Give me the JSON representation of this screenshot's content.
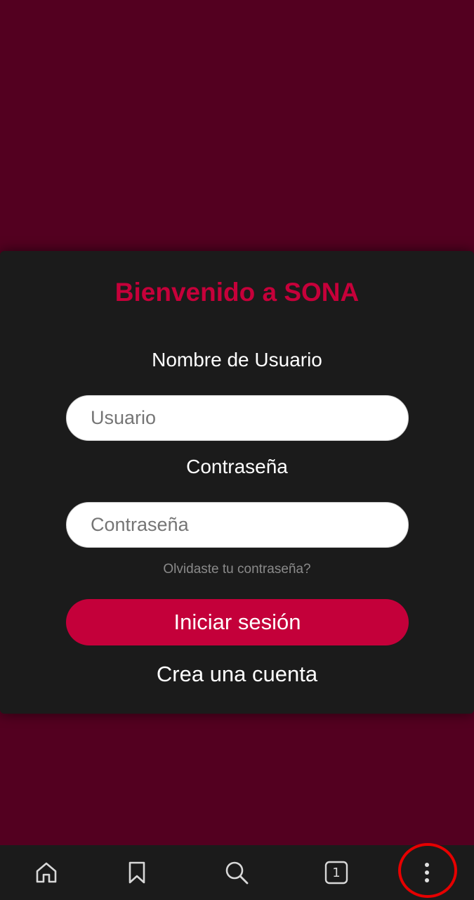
{
  "login": {
    "title": "Bienvenido a SONA",
    "username_label": "Nombre de Usuario",
    "username_placeholder": "Usuario",
    "password_label": "Contraseña",
    "password_placeholder": "Contraseña",
    "forgot_password": "Olvidaste tu contraseña?",
    "login_button": "Iniciar sesión",
    "create_account": "Crea una cuenta"
  },
  "browser_nav": {
    "items": [
      {
        "icon": "home-icon"
      },
      {
        "icon": "bookmark-icon"
      },
      {
        "icon": "search-icon"
      },
      {
        "icon": "tabs-icon",
        "count": "1"
      },
      {
        "icon": "more-vertical-icon"
      }
    ]
  },
  "colors": {
    "page_background": "#530020",
    "card_background": "#1b1b1b",
    "accent": "#c4003a",
    "highlight_ring": "#e60000"
  }
}
